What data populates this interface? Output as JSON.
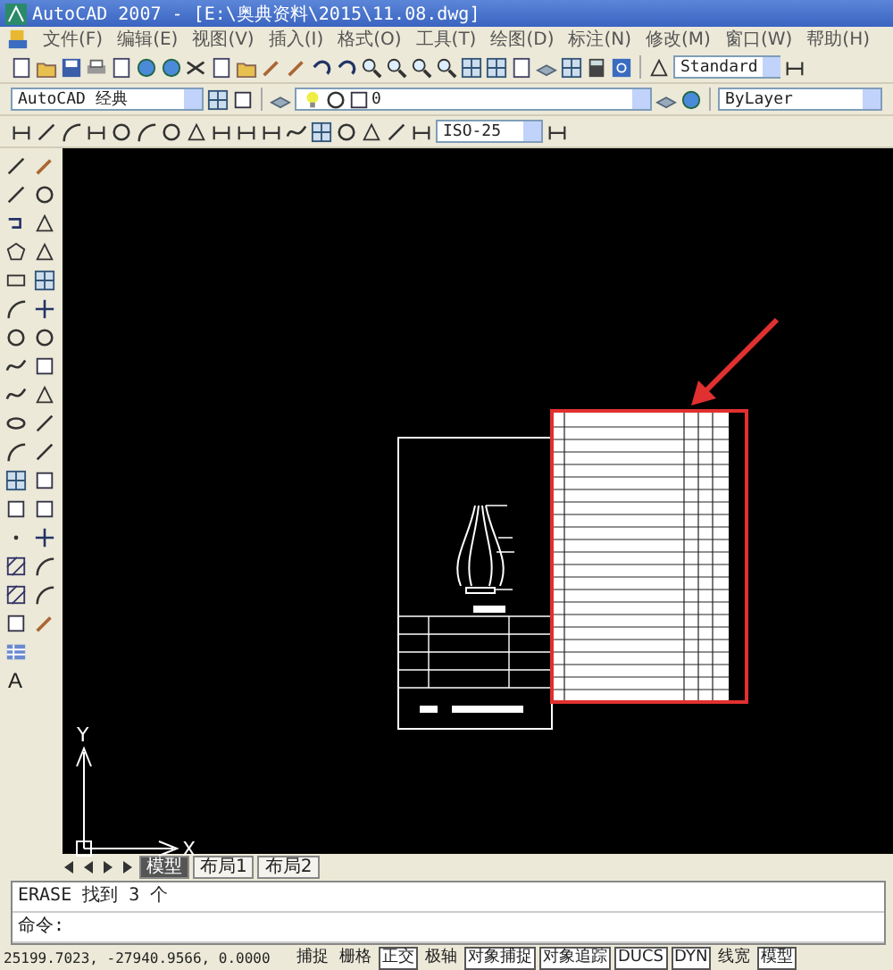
{
  "window": {
    "title": "AutoCAD 2007 - [E:\\奥典资料\\2015\\11.08.dwg]"
  },
  "menu": [
    {
      "label": "文件(F)"
    },
    {
      "label": "编辑(E)"
    },
    {
      "label": "视图(V)"
    },
    {
      "label": "插入(I)"
    },
    {
      "label": "格式(O)"
    },
    {
      "label": "工具(T)"
    },
    {
      "label": "绘图(D)"
    },
    {
      "label": "标注(N)"
    },
    {
      "label": "修改(M)"
    },
    {
      "label": "窗口(W)"
    },
    {
      "label": "帮助(H)"
    }
  ],
  "standard_toolbar": {
    "text_style": "Standard"
  },
  "workspace": {
    "value": "AutoCAD 经典"
  },
  "layer": {
    "value": "0"
  },
  "color": {
    "value": "ByLayer"
  },
  "dimension_toolbar": {
    "dim_style": "ISO-25"
  },
  "draw_toolbar": {
    "text_tool": "A"
  },
  "ucs": {
    "x_label": "X",
    "y_label": "Y"
  },
  "layout_tabs": [
    {
      "label": "模型",
      "selected": true
    },
    {
      "label": "布局1",
      "selected": false
    },
    {
      "label": "布局2",
      "selected": false
    }
  ],
  "command_lines": [
    "ERASE 找到 3 个",
    "命令:"
  ],
  "status_bar": {
    "coordinates": "25199.7023, -27940.9566, 0.0000",
    "toggles": [
      {
        "label": "捕捉",
        "on": false
      },
      {
        "label": "栅格",
        "on": false
      },
      {
        "label": "正交",
        "on": true
      },
      {
        "label": "极轴",
        "on": false
      },
      {
        "label": "对象捕捉",
        "on": true
      },
      {
        "label": "对象追踪",
        "on": true
      },
      {
        "label": "DUCS",
        "on": true
      },
      {
        "label": "DYN",
        "on": true
      },
      {
        "label": "线宽",
        "on": false
      },
      {
        "label": "模型",
        "on": true
      }
    ]
  }
}
